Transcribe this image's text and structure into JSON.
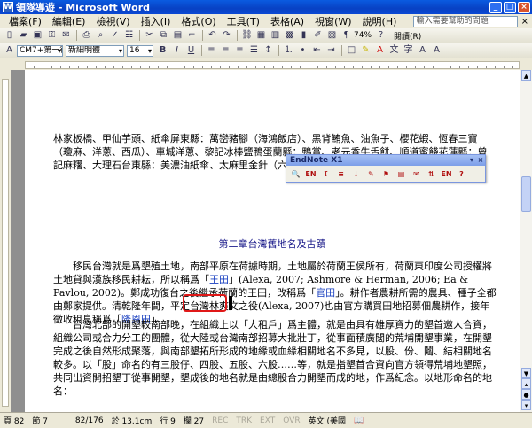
{
  "window": {
    "title": "領隊導遊 - Microsoft Word",
    "app_icon": "W",
    "buttons": [
      "_",
      "□",
      "×"
    ]
  },
  "menu": {
    "items": [
      "檔案(F)",
      "編輯(E)",
      "檢視(V)",
      "插入(I)",
      "格式(O)",
      "工具(T)",
      "表格(A)",
      "視窗(W)",
      "說明(H)"
    ],
    "help_placeholder": "輸入需要幫助的問題",
    "close_doc": "×"
  },
  "toolbar": {
    "zoom": "74%",
    "read_label": "閱讀(R)",
    "style": "CM7+第一行",
    "font": "新細明體",
    "size": "16",
    "bold": "B",
    "italic": "I",
    "underline": "U"
  },
  "endnote": {
    "title": "EndNote X1",
    "buttons": [
      "🔍",
      "EN",
      "↧",
      "≡",
      "↓",
      "✎",
      "⚑",
      "▤",
      "✉",
      "⇅",
      "EN",
      "?"
    ]
  },
  "document": {
    "p1": "林家板橋、甲仙芋頭、紙傘屏東縣：萬巒豬腳（海鴻飯店）、黑背鮪魚、油魚子、櫻花蝦、恆春三寶（瓊麻、洋蔥、西瓜）、車城洋蔥、黎記冰棒鹽鴨蛋蘭縣：鴨賞、老元香牛舌餅、順道蜜餞花蓮縣：曾記麻糬、大理石台東縣：美濃油紙傘、太麻里金針（六十石山）、洛神花、釋迦",
    "heading": "第二章台灣舊地名及古蹟",
    "p2_a": "移民台灣就是爲墾殖土地，南部平原在荷據時期，土地屬於荷蘭王侯所有，荷蘭東印度公司授權將土地貸與漢族移民耕耘，所以稱爲「",
    "p2_wangtian": "王田",
    "p2_b": "」(Alexa, 2007; Ashmore & Herman, 2006; Ea & Pavlou, 2002)。鄭成功復台之後繼承荷蘭的王田，改稱爲「",
    "p2_guantian": "官田",
    "p2_c": "」。耕作者農耕所需的農具、種子全都由鄭家提供。清乾隆年間，平定台灣林爽文之役",
    "p2_cite": "(Alexa, 2007)",
    "p2_d": "也由官方購買田地招募佃農耕作，接年徵收租息稱爲「",
    "p2_longen": "隆恩田",
    "p2_e": "」。",
    "p3": "台灣北部的開墾較南部晚，在組織上以「大租戶」爲主體，就是由具有雄厚資力的墾首邀人合資，組織公司或合力分工的團體，從大陸或台灣南部招募大批壯丁，從事面積廣闊的荒埔開墾事業，在開墾完成之後自然形成聚落，與南部墾拓所形成的地緣或血緣相關地名不多見，以股、份、鬮、結相關地名較多。以「股」命名的有三股仔、四股、五股、六股……等，就是指墾首合資向官方領得荒埔地墾照，共同出資開招墾丁從事開墾，墾成後的地名就是由總股合力開墾而成的地，作爲紀念。以地形命名的地名："
  },
  "status": {
    "page": "頁 82",
    "section": "節 7",
    "pages": "82/176",
    "pos": "於 13.1cm",
    "line": "行 9",
    "col": "欄 27",
    "modes": [
      "REC",
      "TRK",
      "EXT",
      "OVR"
    ],
    "lang": "英文 (美國"
  }
}
